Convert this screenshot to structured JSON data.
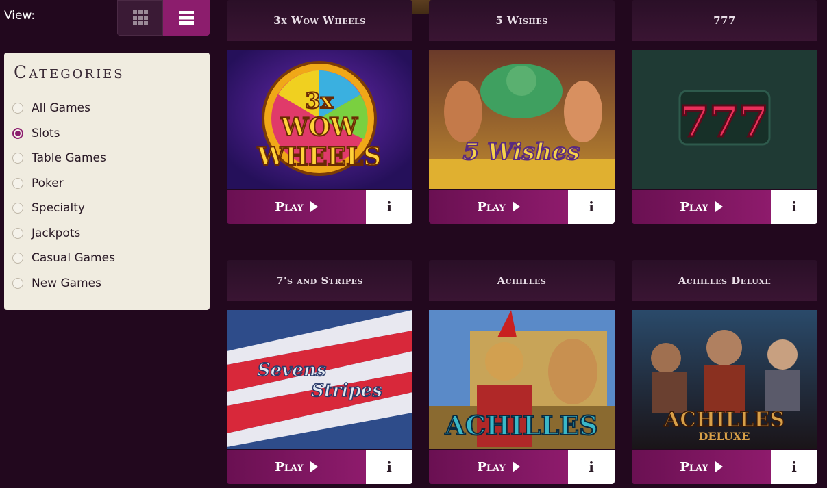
{
  "view": {
    "label": "View:",
    "grid_icon": "grid-icon",
    "list_icon": "list-icon"
  },
  "sidebar": {
    "title": "Categories",
    "items": [
      {
        "label": "All Games",
        "checked": false
      },
      {
        "label": "Slots",
        "checked": true
      },
      {
        "label": "Table Games",
        "checked": false
      },
      {
        "label": "Poker",
        "checked": false
      },
      {
        "label": "Specialty",
        "checked": false
      },
      {
        "label": "Jackpots",
        "checked": false
      },
      {
        "label": "Casual Games",
        "checked": false
      },
      {
        "label": "New Games",
        "checked": false
      }
    ]
  },
  "games": [
    {
      "title": "3x Wow Wheels",
      "logo_lines": [
        "3x",
        "WOW",
        "WHEELS"
      ]
    },
    {
      "title": "5 Wishes",
      "logo_lines": [
        "5 Wishes"
      ]
    },
    {
      "title": "777",
      "logo_lines": [
        "777"
      ]
    },
    {
      "title": "7's and Stripes",
      "logo_lines": [
        "Sevens",
        "Stripes"
      ]
    },
    {
      "title": "Achilles",
      "logo_lines": [
        "ACHILLES"
      ]
    },
    {
      "title": "Achilles Deluxe",
      "logo_lines": [
        "ACHILLES",
        "DELUXE"
      ]
    }
  ],
  "actions": {
    "play_label": "Play",
    "info_label": "i",
    "play_icon": "play-triangle-icon"
  },
  "colors": {
    "accent": "#8c1d6d",
    "background": "#22081e",
    "sidebar_bg": "#f0ece0"
  }
}
